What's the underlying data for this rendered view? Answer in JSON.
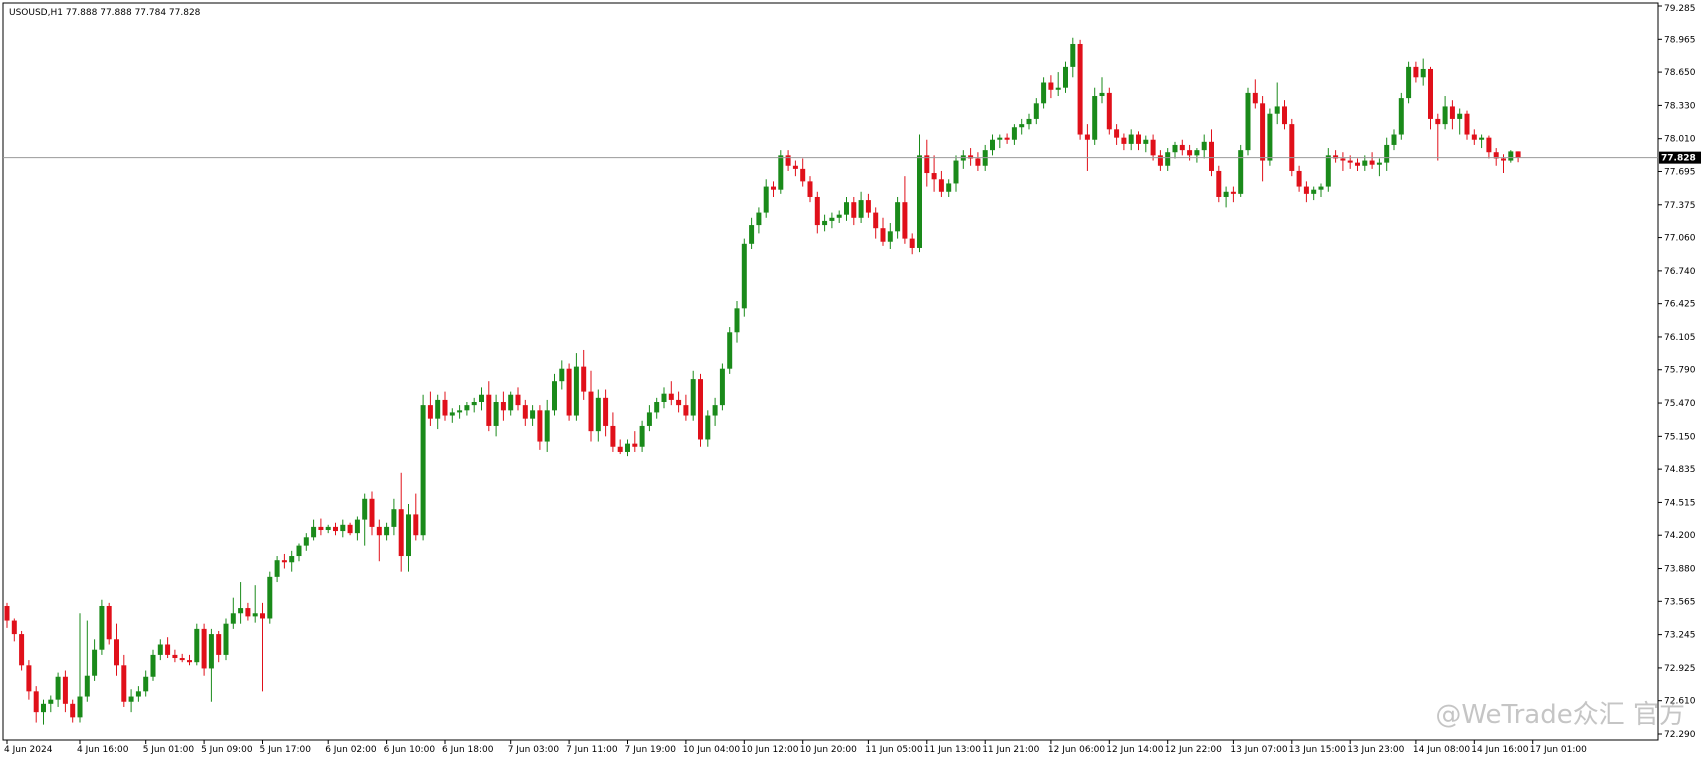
{
  "header": {
    "symbol": "USOUSD,H1",
    "ohlc": "77.888 77.888 77.784 77.828"
  },
  "watermark": "@WeTrade众汇 官方",
  "colors": {
    "bull": "#1a8a1a",
    "bear": "#e0101a",
    "price_line": "#9a9a9a",
    "price_label_bg": "#000000"
  },
  "chart_data": {
    "type": "candlestick",
    "title": "USOUSD,H1",
    "ylim": [
      72.29,
      79.285
    ],
    "grid": false,
    "current_price": 77.828,
    "current_price_label": "77.828",
    "y_ticks": [
      {
        "value": 79.285,
        "label": "79.285"
      },
      {
        "value": 78.965,
        "label": "78.965"
      },
      {
        "value": 78.65,
        "label": "78.650"
      },
      {
        "value": 78.33,
        "label": "78.330"
      },
      {
        "value": 78.01,
        "label": "78.010"
      },
      {
        "value": 77.695,
        "label": "77.695"
      },
      {
        "value": 77.375,
        "label": "77.375"
      },
      {
        "value": 77.06,
        "label": "77.060"
      },
      {
        "value": 76.74,
        "label": "76.740"
      },
      {
        "value": 76.425,
        "label": "76.425"
      },
      {
        "value": 76.105,
        "label": "76.105"
      },
      {
        "value": 75.79,
        "label": "75.790"
      },
      {
        "value": 75.47,
        "label": "75.470"
      },
      {
        "value": 75.15,
        "label": "75.150"
      },
      {
        "value": 74.835,
        "label": "74.835"
      },
      {
        "value": 74.515,
        "label": "74.515"
      },
      {
        "value": 74.2,
        "label": "74.200"
      },
      {
        "value": 73.88,
        "label": "73.880"
      },
      {
        "value": 73.565,
        "label": "73.565"
      },
      {
        "value": 73.245,
        "label": "73.245"
      },
      {
        "value": 72.925,
        "label": "72.925"
      },
      {
        "value": 72.61,
        "label": "72.610"
      },
      {
        "value": 72.29,
        "label": "72.290"
      }
    ],
    "x_ticks": [
      {
        "index": 0,
        "label": "4 Jun 2024"
      },
      {
        "index": 10,
        "label": "4 Jun 16:00"
      },
      {
        "index": 19,
        "label": "5 Jun 01:00"
      },
      {
        "index": 27,
        "label": "5 Jun 09:00"
      },
      {
        "index": 35,
        "label": "5 Jun 17:00"
      },
      {
        "index": 44,
        "label": "6 Jun 02:00"
      },
      {
        "index": 52,
        "label": "6 Jun 10:00"
      },
      {
        "index": 60,
        "label": "6 Jun 18:00"
      },
      {
        "index": 69,
        "label": "7 Jun 03:00"
      },
      {
        "index": 77,
        "label": "7 Jun 11:00"
      },
      {
        "index": 85,
        "label": "7 Jun 19:00"
      },
      {
        "index": 93,
        "label": "10 Jun 04:00"
      },
      {
        "index": 101,
        "label": "10 Jun 12:00"
      },
      {
        "index": 109,
        "label": "10 Jun 20:00"
      },
      {
        "index": 118,
        "label": "11 Jun 05:00"
      },
      {
        "index": 126,
        "label": "11 Jun 13:00"
      },
      {
        "index": 134,
        "label": "11 Jun 21:00"
      },
      {
        "index": 143,
        "label": "12 Jun 06:00"
      },
      {
        "index": 151,
        "label": "12 Jun 14:00"
      },
      {
        "index": 159,
        "label": "12 Jun 22:00"
      },
      {
        "index": 168,
        "label": "13 Jun 07:00"
      },
      {
        "index": 176,
        "label": "13 Jun 15:00"
      },
      {
        "index": 184,
        "label": "13 Jun 23:00"
      },
      {
        "index": 193,
        "label": "14 Jun 08:00"
      },
      {
        "index": 201,
        "label": "14 Jun 16:00"
      },
      {
        "index": 209,
        "label": "17 Jun 01:00"
      }
    ],
    "candles": [
      [
        73.52,
        73.55,
        73.31,
        73.38
      ],
      [
        73.38,
        73.4,
        73.18,
        73.25
      ],
      [
        73.25,
        73.28,
        72.9,
        72.95
      ],
      [
        72.95,
        73.0,
        72.62,
        72.7
      ],
      [
        72.7,
        72.75,
        72.4,
        72.5
      ],
      [
        72.5,
        72.62,
        72.38,
        72.58
      ],
      [
        72.58,
        72.66,
        72.5,
        72.62
      ],
      [
        72.62,
        72.88,
        72.55,
        72.84
      ],
      [
        72.84,
        72.9,
        72.5,
        72.58
      ],
      [
        72.58,
        72.62,
        72.4,
        72.45
      ],
      [
        72.45,
        73.45,
        72.4,
        72.65
      ],
      [
        72.65,
        73.38,
        72.6,
        72.85
      ],
      [
        72.85,
        73.2,
        72.8,
        73.1
      ],
      [
        73.1,
        73.58,
        73.05,
        73.52
      ],
      [
        73.52,
        73.55,
        73.15,
        73.2
      ],
      [
        73.2,
        73.35,
        72.85,
        72.95
      ],
      [
        72.95,
        73.05,
        72.55,
        72.6
      ],
      [
        72.6,
        72.72,
        72.5,
        72.65
      ],
      [
        72.65,
        72.75,
        72.6,
        72.7
      ],
      [
        72.7,
        72.9,
        72.65,
        72.84
      ],
      [
        72.84,
        73.1,
        72.8,
        73.05
      ],
      [
        73.05,
        73.2,
        73.0,
        73.15
      ],
      [
        73.15,
        73.22,
        73.02,
        73.05
      ],
      [
        73.05,
        73.1,
        72.98,
        73.02
      ],
      [
        73.02,
        73.06,
        72.98,
        73.0
      ],
      [
        73.0,
        73.05,
        72.95,
        72.98
      ],
      [
        72.98,
        73.35,
        72.95,
        73.3
      ],
      [
        73.3,
        73.35,
        72.85,
        72.92
      ],
      [
        72.92,
        73.3,
        72.6,
        73.25
      ],
      [
        73.25,
        73.28,
        72.98,
        73.05
      ],
      [
        73.05,
        73.4,
        73.0,
        73.35
      ],
      [
        73.35,
        73.6,
        73.3,
        73.45
      ],
      [
        73.45,
        73.75,
        73.35,
        73.5
      ],
      [
        73.5,
        73.55,
        73.38,
        73.42
      ],
      [
        73.42,
        73.72,
        73.36,
        73.45
      ],
      [
        73.45,
        73.55,
        72.7,
        73.4
      ],
      [
        73.4,
        73.85,
        73.35,
        73.8
      ],
      [
        73.8,
        74.0,
        73.75,
        73.96
      ],
      [
        73.96,
        74.02,
        73.88,
        73.94
      ],
      [
        73.94,
        74.05,
        73.85,
        74.0
      ],
      [
        74.0,
        74.12,
        73.95,
        74.1
      ],
      [
        74.1,
        74.22,
        74.05,
        74.18
      ],
      [
        74.18,
        74.35,
        74.15,
        74.28
      ],
      [
        74.28,
        74.36,
        74.2,
        74.25
      ],
      [
        74.25,
        74.3,
        74.22,
        74.28
      ],
      [
        74.28,
        74.32,
        74.2,
        74.24
      ],
      [
        74.24,
        74.35,
        74.18,
        74.3
      ],
      [
        74.3,
        74.32,
        74.2,
        74.22
      ],
      [
        74.22,
        74.38,
        74.15,
        74.35
      ],
      [
        74.35,
        74.6,
        74.1,
        74.55
      ],
      [
        74.55,
        74.62,
        74.2,
        74.28
      ],
      [
        74.28,
        74.35,
        73.95,
        74.2
      ],
      [
        74.2,
        74.32,
        74.15,
        74.28
      ],
      [
        74.28,
        74.55,
        74.2,
        74.45
      ],
      [
        74.45,
        74.8,
        73.85,
        74.0
      ],
      [
        74.0,
        74.5,
        73.85,
        74.4
      ],
      [
        74.4,
        74.6,
        74.15,
        74.2
      ],
      [
        74.2,
        75.55,
        74.15,
        75.45
      ],
      [
        75.45,
        75.58,
        75.25,
        75.32
      ],
      [
        75.32,
        75.55,
        75.22,
        75.5
      ],
      [
        75.5,
        75.58,
        75.3,
        75.35
      ],
      [
        75.35,
        75.42,
        75.28,
        75.38
      ],
      [
        75.38,
        75.45,
        75.32,
        75.4
      ],
      [
        75.4,
        75.48,
        75.35,
        75.45
      ],
      [
        75.45,
        75.52,
        75.38,
        75.48
      ],
      [
        75.48,
        75.62,
        75.4,
        75.55
      ],
      [
        75.55,
        75.68,
        75.2,
        75.25
      ],
      [
        75.25,
        75.55,
        75.15,
        75.48
      ],
      [
        75.48,
        75.58,
        75.3,
        75.4
      ],
      [
        75.4,
        75.58,
        75.35,
        75.55
      ],
      [
        75.55,
        75.62,
        75.4,
        75.45
      ],
      [
        75.45,
        75.5,
        75.25,
        75.32
      ],
      [
        75.32,
        75.45,
        75.25,
        75.4
      ],
      [
        75.4,
        75.45,
        75.02,
        75.1
      ],
      [
        75.1,
        75.5,
        75.0,
        75.4
      ],
      [
        75.4,
        75.75,
        75.35,
        75.68
      ],
      [
        75.68,
        75.88,
        75.6,
        75.8
      ],
      [
        75.8,
        75.85,
        75.3,
        75.35
      ],
      [
        75.35,
        75.95,
        75.3,
        75.82
      ],
      [
        75.82,
        75.98,
        75.5,
        75.58
      ],
      [
        75.58,
        75.78,
        75.1,
        75.2
      ],
      [
        75.2,
        75.6,
        75.1,
        75.52
      ],
      [
        75.52,
        75.6,
        75.15,
        75.25
      ],
      [
        75.25,
        75.38,
        75.0,
        75.05
      ],
      [
        75.05,
        75.12,
        74.98,
        75.0
      ],
      [
        75.0,
        75.12,
        74.96,
        75.08
      ],
      [
        75.08,
        75.2,
        75.0,
        75.05
      ],
      [
        75.05,
        75.3,
        75.0,
        75.25
      ],
      [
        75.25,
        75.45,
        75.2,
        75.38
      ],
      [
        75.38,
        75.52,
        75.32,
        75.48
      ],
      [
        75.48,
        75.62,
        75.42,
        75.56
      ],
      [
        75.56,
        75.68,
        75.45,
        75.5
      ],
      [
        75.5,
        75.58,
        75.38,
        75.45
      ],
      [
        75.45,
        75.55,
        75.3,
        75.35
      ],
      [
        75.35,
        75.78,
        75.3,
        75.7
      ],
      [
        75.7,
        75.75,
        75.05,
        75.12
      ],
      [
        75.12,
        75.4,
        75.05,
        75.35
      ],
      [
        75.35,
        75.52,
        75.25,
        75.45
      ],
      [
        75.45,
        75.85,
        75.4,
        75.8
      ],
      [
        75.8,
        76.2,
        75.75,
        76.15
      ],
      [
        76.15,
        76.45,
        76.05,
        76.38
      ],
      [
        76.38,
        77.05,
        76.3,
        77.0
      ],
      [
        77.0,
        77.25,
        76.95,
        77.18
      ],
      [
        77.18,
        77.35,
        77.1,
        77.3
      ],
      [
        77.3,
        77.62,
        77.25,
        77.55
      ],
      [
        77.55,
        77.6,
        77.45,
        77.52
      ],
      [
        77.52,
        77.9,
        77.48,
        77.85
      ],
      [
        77.85,
        77.9,
        77.7,
        77.75
      ],
      [
        77.75,
        77.8,
        77.65,
        77.72
      ],
      [
        77.72,
        77.82,
        77.55,
        77.6
      ],
      [
        77.6,
        77.65,
        77.4,
        77.45
      ],
      [
        77.45,
        77.5,
        77.1,
        77.18
      ],
      [
        77.18,
        77.28,
        77.12,
        77.22
      ],
      [
        77.22,
        77.3,
        77.15,
        77.25
      ],
      [
        77.25,
        77.32,
        77.2,
        77.28
      ],
      [
        77.28,
        77.45,
        77.22,
        77.4
      ],
      [
        77.4,
        77.45,
        77.18,
        77.25
      ],
      [
        77.25,
        77.5,
        77.2,
        77.42
      ],
      [
        77.42,
        77.48,
        77.25,
        77.3
      ],
      [
        77.3,
        77.35,
        77.05,
        77.15
      ],
      [
        77.15,
        77.25,
        76.98,
        77.02
      ],
      [
        77.02,
        77.2,
        76.95,
        77.12
      ],
      [
        77.12,
        77.45,
        77.05,
        77.4
      ],
      [
        77.4,
        77.65,
        77.0,
        77.05
      ],
      [
        77.05,
        77.1,
        76.9,
        76.96
      ],
      [
        76.96,
        78.05,
        76.92,
        77.85
      ],
      [
        77.85,
        78.0,
        77.55,
        77.68
      ],
      [
        77.68,
        77.85,
        77.5,
        77.62
      ],
      [
        77.62,
        77.7,
        77.45,
        77.5
      ],
      [
        77.5,
        77.62,
        77.45,
        77.58
      ],
      [
        77.58,
        77.85,
        77.5,
        77.8
      ],
      [
        77.8,
        77.9,
        77.72,
        77.85
      ],
      [
        77.85,
        77.92,
        77.75,
        77.82
      ],
      [
        77.82,
        77.88,
        77.7,
        77.75
      ],
      [
        77.75,
        77.95,
        77.7,
        77.9
      ],
      [
        77.9,
        78.05,
        77.85,
        78.0
      ],
      [
        78.0,
        78.05,
        77.92,
        78.02
      ],
      [
        78.02,
        78.06,
        77.96,
        78.0
      ],
      [
        78.0,
        78.15,
        77.95,
        78.12
      ],
      [
        78.12,
        78.2,
        78.05,
        78.15
      ],
      [
        78.15,
        78.25,
        78.1,
        78.2
      ],
      [
        78.2,
        78.4,
        78.15,
        78.35
      ],
      [
        78.35,
        78.6,
        78.3,
        78.55
      ],
      [
        78.55,
        78.62,
        78.4,
        78.48
      ],
      [
        78.48,
        78.65,
        78.42,
        78.5
      ],
      [
        78.5,
        78.75,
        78.45,
        78.7
      ],
      [
        78.7,
        78.98,
        78.6,
        78.92
      ],
      [
        78.92,
        78.96,
        78.0,
        78.05
      ],
      [
        78.05,
        78.15,
        77.7,
        78.0
      ],
      [
        78.0,
        78.5,
        77.95,
        78.42
      ],
      [
        78.42,
        78.6,
        78.35,
        78.45
      ],
      [
        78.45,
        78.5,
        78.05,
        78.1
      ],
      [
        78.1,
        78.15,
        77.95,
        78.02
      ],
      [
        78.02,
        78.06,
        77.9,
        77.96
      ],
      [
        77.96,
        78.1,
        77.9,
        78.05
      ],
      [
        78.05,
        78.08,
        77.9,
        77.96
      ],
      [
        77.96,
        78.04,
        77.88,
        78.0
      ],
      [
        78.0,
        78.05,
        77.8,
        77.85
      ],
      [
        77.85,
        77.9,
        77.7,
        77.75
      ],
      [
        77.75,
        77.92,
        77.7,
        77.88
      ],
      [
        77.88,
        77.98,
        77.82,
        77.95
      ],
      [
        77.95,
        78.0,
        77.85,
        77.9
      ],
      [
        77.9,
        77.95,
        77.8,
        77.85
      ],
      [
        77.85,
        77.92,
        77.78,
        77.9
      ],
      [
        77.9,
        78.05,
        77.82,
        77.98
      ],
      [
        77.98,
        78.1,
        77.65,
        77.7
      ],
      [
        77.7,
        77.75,
        77.4,
        77.45
      ],
      [
        77.45,
        77.55,
        77.35,
        77.5
      ],
      [
        77.5,
        77.55,
        77.4,
        77.48
      ],
      [
        77.48,
        77.95,
        77.45,
        77.9
      ],
      [
        77.9,
        78.5,
        77.85,
        78.45
      ],
      [
        78.45,
        78.58,
        78.3,
        78.35
      ],
      [
        78.35,
        78.42,
        77.6,
        77.8
      ],
      [
        77.8,
        78.3,
        77.75,
        78.25
      ],
      [
        78.25,
        78.55,
        78.15,
        78.32
      ],
      [
        78.32,
        78.38,
        78.1,
        78.15
      ],
      [
        78.15,
        78.2,
        77.65,
        77.7
      ],
      [
        77.7,
        77.75,
        77.5,
        77.55
      ],
      [
        77.55,
        77.6,
        77.4,
        77.48
      ],
      [
        77.48,
        77.55,
        77.42,
        77.52
      ],
      [
        77.52,
        77.58,
        77.45,
        77.55
      ],
      [
        77.55,
        77.92,
        77.5,
        77.85
      ],
      [
        77.85,
        77.9,
        77.78,
        77.82
      ],
      [
        77.82,
        77.88,
        77.7,
        77.8
      ],
      [
        77.8,
        77.85,
        77.72,
        77.78
      ],
      [
        77.78,
        77.82,
        77.7,
        77.75
      ],
      [
        77.75,
        77.85,
        77.7,
        77.8
      ],
      [
        77.8,
        77.88,
        77.72,
        77.76
      ],
      [
        77.76,
        77.82,
        77.65,
        77.78
      ],
      [
        77.78,
        78.02,
        77.7,
        77.95
      ],
      [
        77.95,
        78.1,
        77.9,
        78.05
      ],
      [
        78.05,
        78.45,
        78.0,
        78.4
      ],
      [
        78.4,
        78.75,
        78.35,
        78.7
      ],
      [
        78.7,
        78.75,
        78.55,
        78.6
      ],
      [
        78.6,
        78.78,
        78.52,
        78.68
      ],
      [
        78.68,
        78.7,
        78.1,
        78.2
      ],
      [
        78.2,
        78.25,
        77.8,
        78.15
      ],
      [
        78.15,
        78.42,
        78.1,
        78.32
      ],
      [
        78.32,
        78.38,
        78.1,
        78.2
      ],
      [
        78.2,
        78.3,
        78.05,
        78.25
      ],
      [
        78.25,
        78.28,
        78.0,
        78.05
      ],
      [
        78.05,
        78.1,
        77.95,
        78.0
      ],
      [
        78.0,
        78.05,
        77.92,
        78.02
      ],
      [
        78.02,
        78.04,
        77.82,
        77.88
      ],
      [
        77.88,
        77.92,
        77.75,
        77.82
      ],
      [
        77.82,
        77.86,
        77.68,
        77.8
      ],
      [
        77.8,
        77.9,
        77.78,
        77.888
      ],
      [
        77.888,
        77.888,
        77.784,
        77.828
      ]
    ]
  }
}
